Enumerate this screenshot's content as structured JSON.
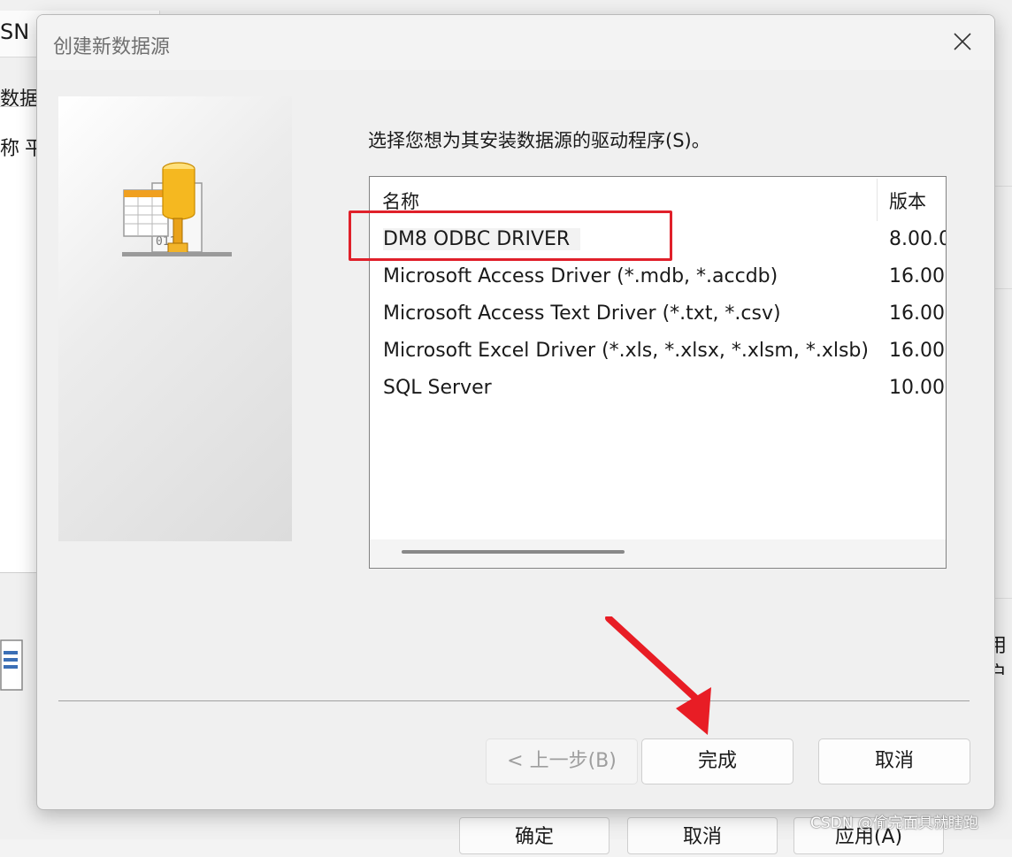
{
  "background": {
    "tab_label": "SN",
    "sub_label": "数据源",
    "col1": "称",
    "col2": "平",
    "right_text": "用户",
    "buttons": [
      "确定",
      "取消",
      "应用(A)"
    ]
  },
  "dialog": {
    "title": "创建新数据源",
    "prompt": "选择您想为其安装数据源的驱动程序(S)。",
    "columns": {
      "name": "名称",
      "version": "版本"
    },
    "drivers": [
      {
        "name": "DM8 ODBC DRIVER",
        "version": "8.00.0"
      },
      {
        "name": "Microsoft Access Driver (*.mdb, *.accdb)",
        "version": "16.00"
      },
      {
        "name": "Microsoft Access Text Driver (*.txt, *.csv)",
        "version": "16.00"
      },
      {
        "name": "Microsoft Excel Driver (*.xls, *.xlsx, *.xlsm, *.xlsb)",
        "version": "16.00"
      },
      {
        "name": "SQL Server",
        "version": "10.00"
      }
    ],
    "selected_index": 0,
    "back_label": "< 上一步(B)",
    "finish_label": "完成",
    "cancel_label": "取消"
  },
  "annotation": {
    "highlight_color": "#e0202a",
    "arrow_color": "#e81d25"
  },
  "watermark": "CSDN @偷完面具就瞎跑"
}
